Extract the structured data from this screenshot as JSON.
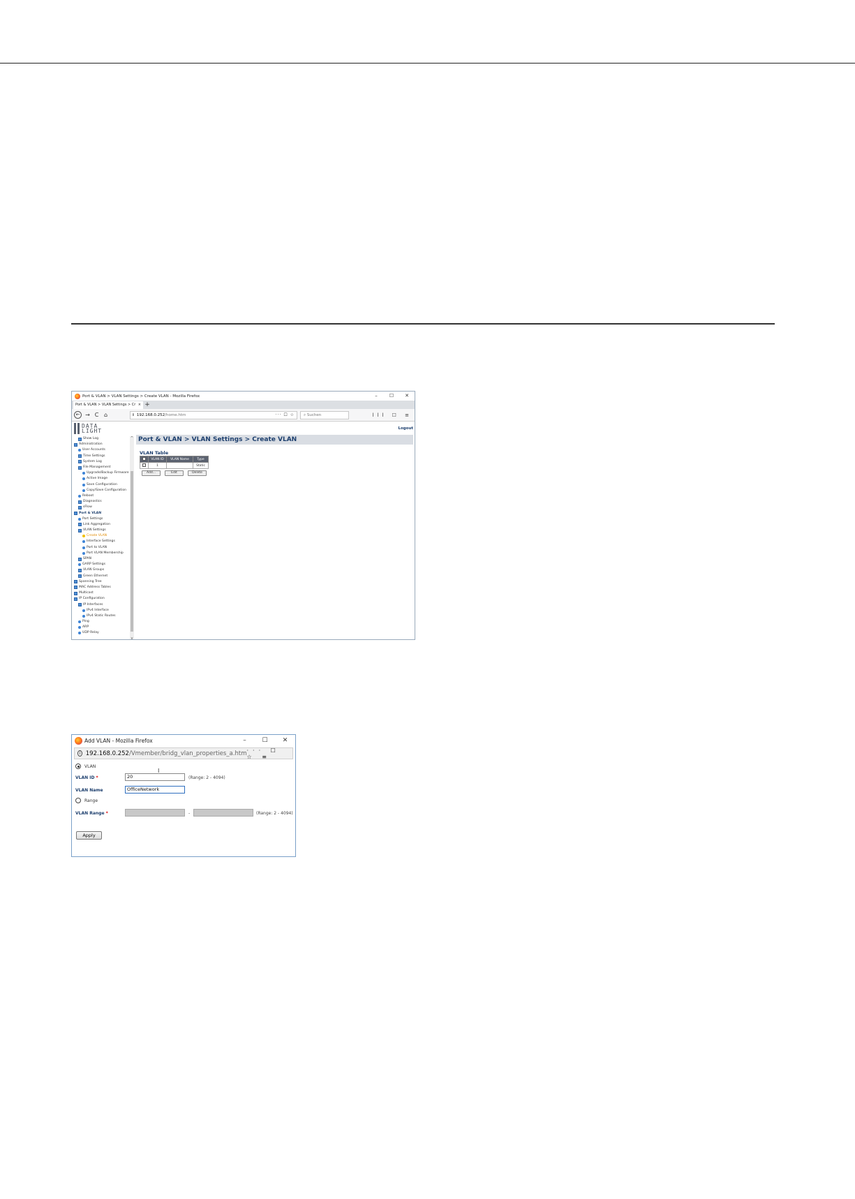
{
  "shot1": {
    "window_title": "Port & VLAN > VLAN Settings > Create VLAN - Mozilla Firefox",
    "tab_label": "Port & VLAN > VLAN Settings > Cr",
    "tab_close": "×",
    "new_tab": "+",
    "nav": {
      "back": "←",
      "forward": "→",
      "reload": "C",
      "home": "⌂"
    },
    "url_info": "i",
    "url_host": "192.168.0.252",
    "url_path": "/home.htm",
    "url_icons": "··· ☐ ☆",
    "search_placeholder": "Suchen",
    "toolbar_icons": "lll ☐ ≡",
    "win_controls": {
      "min": "–",
      "max": "☐",
      "close": "✕"
    },
    "logo_line1": "DATA",
    "logo_line2": "LIGHT",
    "logout": "Logout",
    "sidebar": [
      {
        "label": "Show Log",
        "icon": "box",
        "level": 1
      },
      {
        "label": "Administration",
        "icon": "box",
        "level": 0
      },
      {
        "label": "User Accounts",
        "icon": "dot",
        "level": 1
      },
      {
        "label": "Time Settings",
        "icon": "box",
        "level": 1
      },
      {
        "label": "System Log",
        "icon": "box",
        "level": 1
      },
      {
        "label": "File Management",
        "icon": "box",
        "level": 1
      },
      {
        "label": "Upgrade/Backup Firmware",
        "icon": "dot",
        "level": 2
      },
      {
        "label": "Active Image",
        "icon": "dot",
        "level": 2
      },
      {
        "label": "Save Configuration",
        "icon": "dot",
        "level": 2
      },
      {
        "label": "Copy/Save Configuration",
        "icon": "dot",
        "level": 2
      },
      {
        "label": "Reboot",
        "icon": "dot",
        "level": 1
      },
      {
        "label": "Diagnostics",
        "icon": "box",
        "level": 1
      },
      {
        "label": "sFlow",
        "icon": "box",
        "level": 1
      },
      {
        "label": "Port & VLAN",
        "icon": "box",
        "level": 0,
        "style": "strong"
      },
      {
        "label": "Port Settings",
        "icon": "dot",
        "level": 1
      },
      {
        "label": "Link Aggregation",
        "icon": "box",
        "level": 1
      },
      {
        "label": "VLAN Settings",
        "icon": "box",
        "level": 1
      },
      {
        "label": "Create VLAN",
        "icon": "dot",
        "level": 2,
        "style": "selected"
      },
      {
        "label": "Interface Settings",
        "icon": "dot",
        "level": 2
      },
      {
        "label": "Port to VLAN",
        "icon": "dot",
        "level": 2
      },
      {
        "label": "Port VLAN Membership",
        "icon": "dot",
        "level": 2
      },
      {
        "label": "SPAN",
        "icon": "box",
        "level": 1
      },
      {
        "label": "GARP Settings",
        "icon": "dot",
        "level": 1
      },
      {
        "label": "VLAN Groups",
        "icon": "box",
        "level": 1
      },
      {
        "label": "Green Ethernet",
        "icon": "box",
        "level": 1
      },
      {
        "label": "Spanning Tree",
        "icon": "box",
        "level": 0
      },
      {
        "label": "MAC Address Tables",
        "icon": "box",
        "level": 0
      },
      {
        "label": "Multicast",
        "icon": "box",
        "level": 0
      },
      {
        "label": "IP Configuration",
        "icon": "box",
        "level": 0
      },
      {
        "label": "IP Interfaces",
        "icon": "box",
        "level": 1
      },
      {
        "label": "IPv4 Interface",
        "icon": "dot",
        "level": 2
      },
      {
        "label": "IPv4 Static Routes",
        "icon": "dot",
        "level": 2
      },
      {
        "label": "Ping",
        "icon": "dot",
        "level": 1
      },
      {
        "label": "ARP",
        "icon": "dot",
        "level": 1
      },
      {
        "label": "UDP Relay",
        "icon": "dot",
        "level": 1
      }
    ],
    "page_heading": "Port & VLAN > VLAN Settings > Create VLAN",
    "vlan_table": {
      "title": "VLAN Table",
      "columns": [
        "VLAN ID",
        "VLAN Name",
        "Type"
      ],
      "rows": [
        {
          "id": "1",
          "name": "",
          "type": "Static"
        }
      ],
      "buttons": {
        "add": "Add...",
        "edit": "Edit",
        "delete": "Delete"
      }
    },
    "scroll_arrows": {
      "up": "^",
      "down": "v"
    }
  },
  "shot2": {
    "window_title": "Add VLAN - Mozilla Firefox",
    "win_controls": {
      "min": "–",
      "max": "☐",
      "close": "✕"
    },
    "url_info": "i",
    "url_host": "192.168.0.252",
    "url_path": "/Vmember/bridg_vlan_properties_a.htm",
    "url_icons": "··· ☐ ☆ ≡",
    "form": {
      "radio_vlan": "VLAN",
      "vlan_id_label": "VLAN ID",
      "required_mark": "*",
      "vlan_id_value": "20",
      "vlan_id_range": "(Range: 2 - 4094)",
      "vlan_name_label": "VLAN Name",
      "vlan_name_value": "OfficeNetwork",
      "radio_range": "Range",
      "vlan_range_label": "VLAN Range",
      "range_separator": "-",
      "vlan_range_hint": "(Range: 2 - 4094)",
      "apply": "Apply",
      "text_cursor": "I"
    }
  }
}
